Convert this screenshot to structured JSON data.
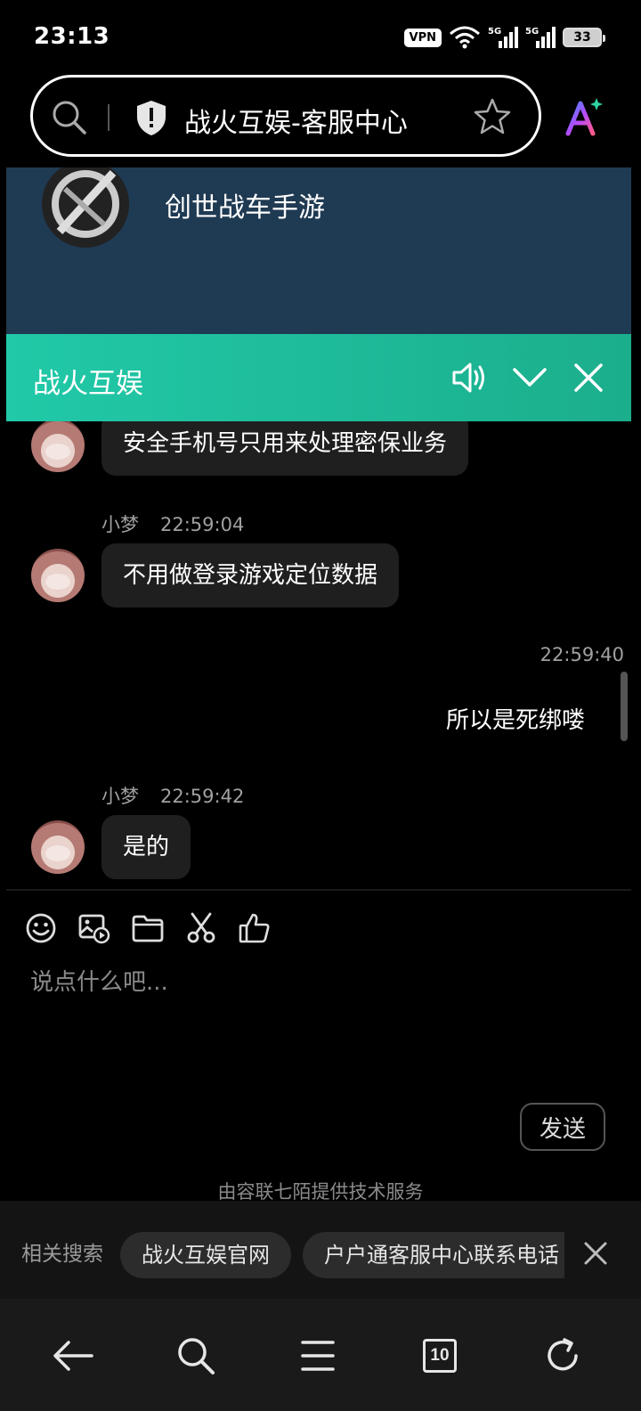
{
  "status_bar": {
    "time": "23:13",
    "vpn": "VPN",
    "battery": "33",
    "icons": [
      "vpn-icon",
      "wifi-icon",
      "signal-5g-icon",
      "signal-5g-icon",
      "battery-icon"
    ]
  },
  "address_bar": {
    "title": "战火互娱-客服中心",
    "icons": [
      "search-icon",
      "shield-icon",
      "star-icon",
      "ai-icon"
    ]
  },
  "banner": {
    "game_name": "创世战车手游"
  },
  "chat_header": {
    "title": "战火互娱",
    "icons": [
      "speaker-icon",
      "chevron-down-icon",
      "close-icon"
    ]
  },
  "messages": [
    {
      "from": "agent",
      "text": "安全手机号只用来处理密保业务"
    },
    {
      "from": "agent",
      "sender": "小梦",
      "time": "22:59:04",
      "text": "不用做登录游戏定位数据"
    },
    {
      "from": "me",
      "time": "22:59:40",
      "text": "所以是死绑喽"
    },
    {
      "from": "agent",
      "sender": "小梦",
      "time": "22:59:42",
      "text": "是的"
    }
  ],
  "composer": {
    "placeholder": "说点什么吧...",
    "send_label": "发送",
    "tools": [
      "emoji-icon",
      "image-icon",
      "folder-icon",
      "scissors-icon",
      "thumbs-up-icon"
    ]
  },
  "powered_by": "由容联七陌提供技术服务",
  "related_search": {
    "label": "相关搜索",
    "chips": [
      "战火互娱官网",
      "户户通客服中心联系电话"
    ]
  },
  "bottom_nav": {
    "tab_count": "10",
    "icons": [
      "back-arrow-icon",
      "search-icon",
      "menu-icon",
      "tabs-icon",
      "refresh-icon"
    ]
  }
}
